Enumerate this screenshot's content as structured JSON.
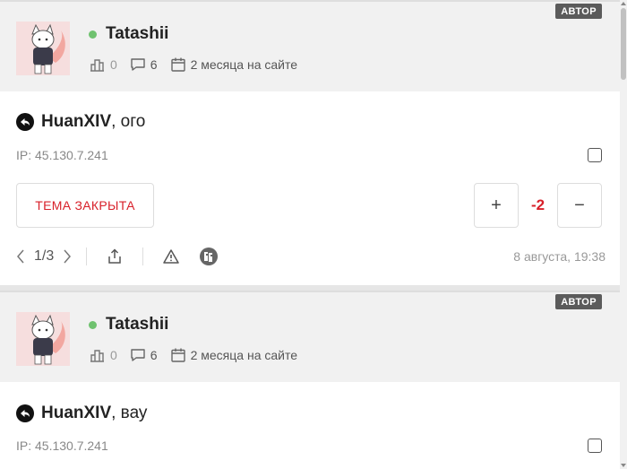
{
  "posts": [
    {
      "author_badge": "АВТОР",
      "username": "Tatashii",
      "likes": "0",
      "comments": "6",
      "on_site": "2 месяца на сайте",
      "reply_to": "HuanXIV",
      "message": ", ого",
      "ip": "IP: 45.130.7.241",
      "closed_label": "ТЕМА ЗАКРЫТА",
      "plus": "+",
      "score": "-2",
      "minus": "−",
      "pager": "1/3",
      "timestamp": "8 августа, 19:38"
    },
    {
      "author_badge": "АВТОР",
      "username": "Tatashii",
      "likes": "0",
      "comments": "6",
      "on_site": "2 месяца на сайте",
      "reply_to": "HuanXIV",
      "message": ", вау",
      "ip": "IP: 45.130.7.241"
    }
  ],
  "colors": {
    "accent_red": "#d8202a",
    "online_green": "#6fc26f",
    "badge_bg": "#5b5b5b"
  }
}
